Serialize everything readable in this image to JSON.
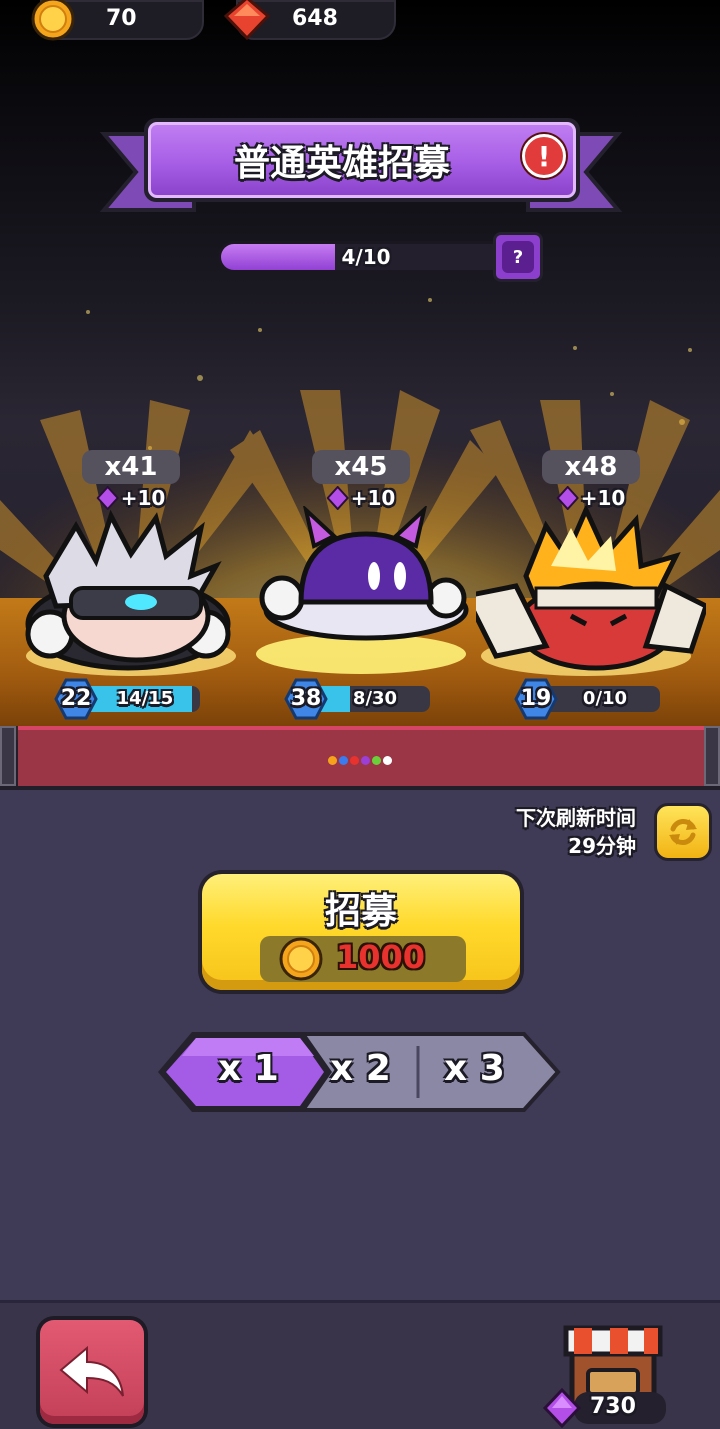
{
  "currencies": {
    "gold": {
      "icon": "gold-coin-icon",
      "value": "70"
    },
    "ruby": {
      "icon": "red-gem-icon",
      "value": "648"
    }
  },
  "banner": {
    "title": "普通英雄招募",
    "alert_icon": "alert-icon",
    "alert_glyph": "!"
  },
  "progress": {
    "text": "4/10",
    "current": 4,
    "max": 10,
    "help_glyph": "?"
  },
  "heroes": [
    {
      "count": "x41",
      "bonus": "+10",
      "level": "22",
      "shards": "14/15",
      "fill": 0.93,
      "icon": "white-haired-visor-hero"
    },
    {
      "count": "x45",
      "bonus": "+10",
      "level": "38",
      "shards": "8/30",
      "fill": 0.27,
      "icon": "purple-slime-ufo-hero"
    },
    {
      "count": "x48",
      "bonus": "+10",
      "level": "19",
      "shards": "0/10",
      "fill": 0.0,
      "icon": "fire-haired-mummy-hero"
    }
  ],
  "page_dots": [
    "#f7a21b",
    "#3a7cf0",
    "#e8322e",
    "#9b3fd6",
    "#6ad13a",
    "#ffffff"
  ],
  "refresh": {
    "label": "下次刷新时间",
    "time": "29分钟",
    "icon": "refresh-icon"
  },
  "recruit": {
    "label": "招募",
    "cost": "1000",
    "cost_icon": "gold-coin-icon"
  },
  "multiplier": {
    "options": [
      "x 1",
      "x 2",
      "x 3"
    ],
    "selected": 0
  },
  "bottom": {
    "back_icon": "back-arrow-icon",
    "shop_icon": "shop-icon",
    "shop_currency_icon": "purple-gem-icon",
    "shop_value": "730"
  },
  "colors": {
    "purple": "#a75ee6",
    "yellow": "#ffd92b",
    "back_red": "#c33f58",
    "shard_blue": "#39c2ea"
  }
}
